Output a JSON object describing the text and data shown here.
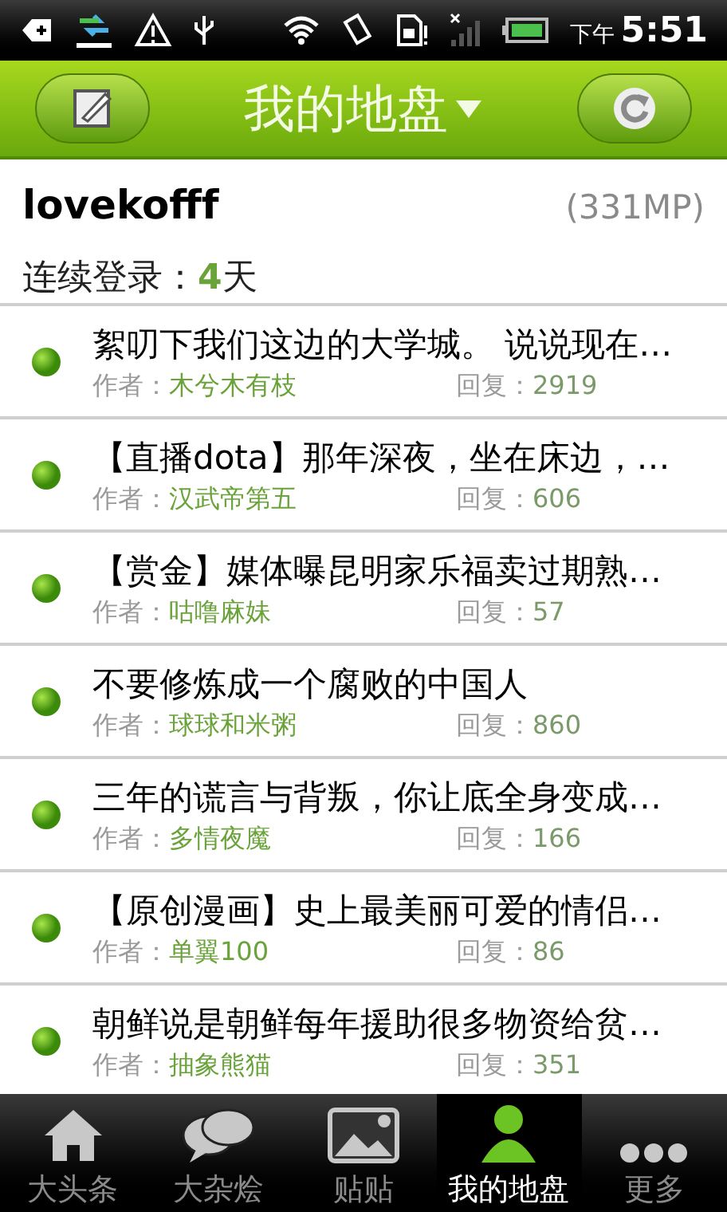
{
  "status_bar": {
    "period": "下午",
    "time": "5:51"
  },
  "header": {
    "title": "我的地盘"
  },
  "profile": {
    "username": "lovekofff",
    "points": "(331MP)",
    "streak_label": "连续登录：",
    "streak_days": "4",
    "streak_unit": "天"
  },
  "posts": [
    {
      "title": "絮叨下我们这边的大学城。 说说现在…",
      "author_label": "作者：",
      "author": "木兮木有枝",
      "reply_label": "回复：",
      "replies": "2919"
    },
    {
      "title": "【直播dota】那年深夜，坐在床边，…",
      "author_label": "作者：",
      "author": "汉武帝第五",
      "reply_label": "回复：",
      "replies": "606"
    },
    {
      "title": "【赏金】媒体曝昆明家乐福卖过期熟…",
      "author_label": "作者：",
      "author": "咕噜麻妹",
      "reply_label": "回复：",
      "replies": "57"
    },
    {
      "title": "不要修炼成一个腐败的中国人",
      "author_label": "作者：",
      "author": "球球和米粥",
      "reply_label": "回复：",
      "replies": "860"
    },
    {
      "title": "三年的谎言与背叛，你让底全身变成…",
      "author_label": "作者：",
      "author": "多情夜魔",
      "reply_label": "回复：",
      "replies": "166"
    },
    {
      "title": "【原创漫画】史上最美丽可爱的情侣…",
      "author_label": "作者：",
      "author": "单翼100",
      "reply_label": "回复：",
      "replies": "86"
    },
    {
      "title": "朝鲜说是朝鲜每年援助很多物资给贫…",
      "author_label": "作者：",
      "author": "抽象熊猫",
      "reply_label": "回复：",
      "replies": "351"
    }
  ],
  "tabs": [
    {
      "label": "大头条",
      "kind": "home",
      "selected": false
    },
    {
      "label": "大杂烩",
      "kind": "chat",
      "selected": false
    },
    {
      "label": "贴贴",
      "kind": "image",
      "selected": false
    },
    {
      "label": "我的地盘",
      "kind": "person",
      "selected": true
    },
    {
      "label": "更多",
      "kind": "more",
      "selected": false
    }
  ]
}
